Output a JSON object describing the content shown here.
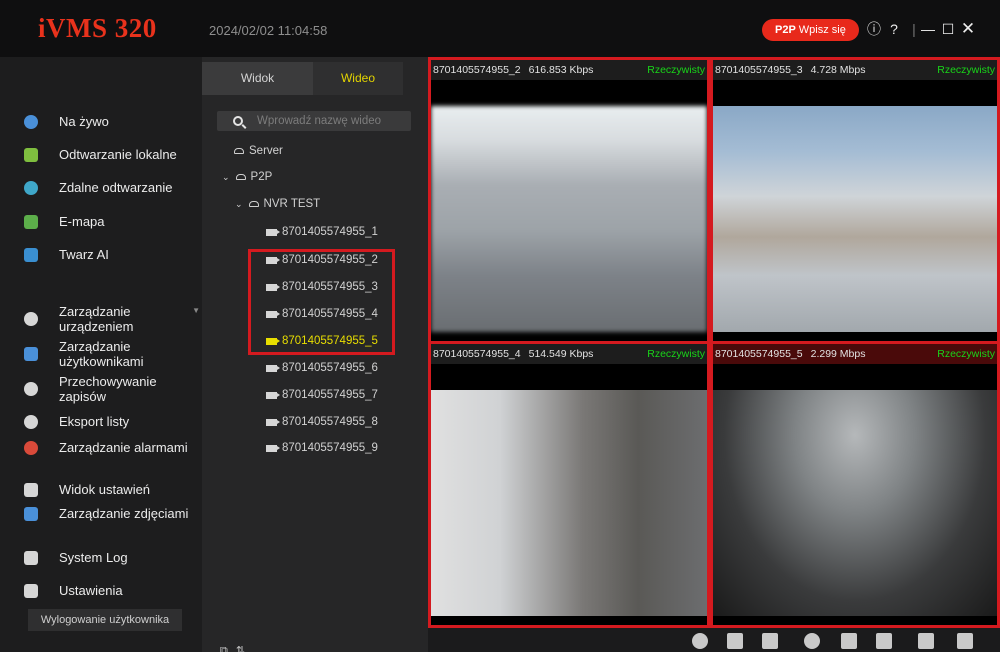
{
  "app": {
    "logo": "iVMS 320",
    "datetime": "2024/02/02 11:04:58",
    "p2p_badge": "P2P",
    "login_label": "Wpisz się"
  },
  "sidebar": {
    "items": [
      {
        "label": "Na żywo",
        "icon": "live-view-icon",
        "color": "#4a90d9"
      },
      {
        "label": "Odtwarzanie lokalne",
        "icon": "local-playback-icon",
        "color": "#7fbf3f"
      },
      {
        "label": "Zdalne odtwarzanie",
        "icon": "remote-playback-icon",
        "color": "#3fa7c9"
      },
      {
        "label": "E-mapa",
        "icon": "emap-icon",
        "color": "#5cae4a"
      },
      {
        "label": "Twarz AI",
        "icon": "face-ai-icon",
        "color": "#3a8fd1"
      },
      {
        "label": "Zarządzanie urządzeniem",
        "icon": "device-management-icon",
        "color": "#d6d6d6"
      },
      {
        "label": "Zarządzanie użytkownikami",
        "icon": "user-management-icon",
        "color": "#4a90d9"
      },
      {
        "label": "Przechowywanie zapisów",
        "icon": "storage-icon",
        "color": "#d6d6d6"
      },
      {
        "label": "Eksport listy",
        "icon": "export-list-icon",
        "color": "#d6d6d6"
      },
      {
        "label": "Zarządzanie alarmami",
        "icon": "alarm-icon",
        "color": "#d94a3a"
      },
      {
        "label": "Widok ustawień",
        "icon": "layout-settings-icon",
        "color": "#d6d6d6"
      },
      {
        "label": "Zarządzanie zdjęciami",
        "icon": "picture-management-icon",
        "color": "#4a90d9"
      },
      {
        "label": "System Log",
        "icon": "system-log-icon",
        "color": "#d6d6d6"
      },
      {
        "label": "Ustawienia",
        "icon": "settings-icon",
        "color": "#d6d6d6"
      }
    ],
    "logout_label": "Wylogowanie użytkownika"
  },
  "panel": {
    "tabs": [
      "Widok",
      "Wideo"
    ],
    "active_tab": "Wideo",
    "search_placeholder": "Wprowadź nazwę wideo",
    "tree": {
      "server": "Server",
      "p2p": "P2P",
      "nvr": "NVR TEST",
      "channels": [
        "8701405574955_1",
        "8701405574955_2",
        "8701405574955_3",
        "8701405574955_4",
        "8701405574955_5",
        "8701405574955_6",
        "8701405574955_7",
        "8701405574955_8",
        "8701405574955_9"
      ],
      "selected_channel": "8701405574955_5"
    }
  },
  "video": {
    "live_label": "Rzeczywisty",
    "panes": [
      {
        "channel": "8701405574955_2",
        "bitrate": "616.853 Kbps"
      },
      {
        "channel": "8701405574955_3",
        "bitrate": "4.728 Mbps"
      },
      {
        "channel": "8701405574955_4",
        "bitrate": "514.549 Kbps"
      },
      {
        "channel": "8701405574955_5",
        "bitrate": "2.299 Mbps"
      }
    ]
  },
  "colors": {
    "accent_red": "#e8291b",
    "highlight_border": "#d41a1f",
    "selected_yellow": "#e8de00",
    "live_green": "#19d519"
  }
}
